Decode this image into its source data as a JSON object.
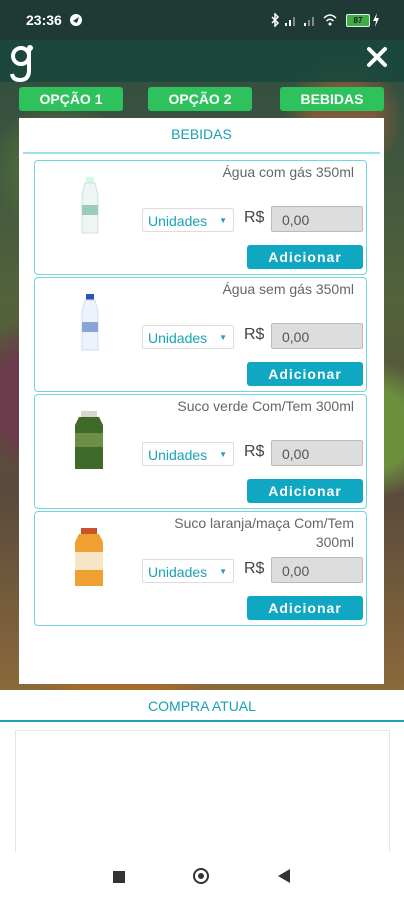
{
  "status_bar": {
    "time": "23:36",
    "battery": "87"
  },
  "tabs": [
    {
      "label": "OPÇÃO 1"
    },
    {
      "label": "OPÇÃO 2"
    },
    {
      "label": "BEBIDAS"
    }
  ],
  "panel": {
    "title": "BEBIDAS",
    "products": [
      {
        "name": "Água com gás 350ml",
        "unit": "Unidades",
        "currency": "R$",
        "price": "0,00",
        "button": "Adicionar",
        "image": "water-bottle-clear-icon"
      },
      {
        "name": "Água sem gás 350ml",
        "unit": "Unidades",
        "currency": "R$",
        "price": "0,00",
        "button": "Adicionar",
        "image": "water-bottle-blue-cap-icon"
      },
      {
        "name": "Suco verde Com/Tem 300ml",
        "unit": "Unidades",
        "currency": "R$",
        "price": "0,00",
        "button": "Adicionar",
        "image": "green-juice-bottle-icon"
      },
      {
        "name": "Suco laranja/maça Com/Tem 300ml",
        "unit": "Unidades",
        "currency": "R$",
        "price": "0,00",
        "button": "Adicionar",
        "image": "orange-juice-bottle-icon"
      }
    ]
  },
  "cart": {
    "title": "COMPRA ATUAL"
  },
  "colors": {
    "accent": "#10a7c3",
    "tab": "#2ec25c",
    "border": "#6fd6df"
  }
}
